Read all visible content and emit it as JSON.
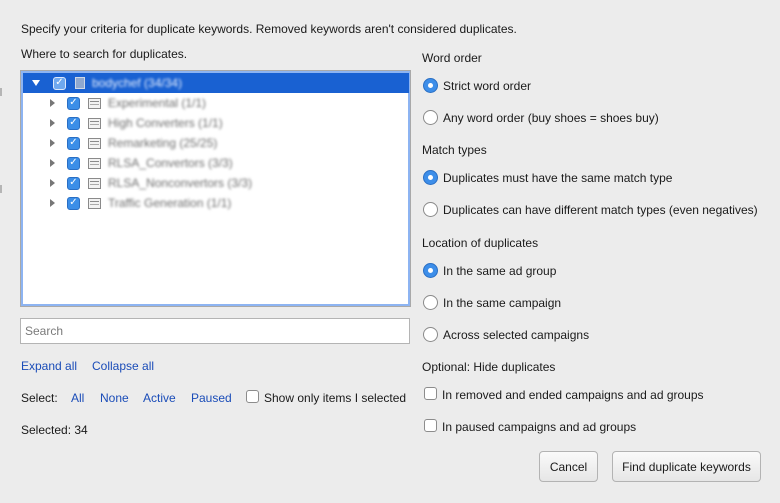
{
  "intro": "Specify your criteria for duplicate keywords. Removed keywords aren't considered duplicates.",
  "tree": {
    "label": "Where to search for duplicates.",
    "root": "bodychef (34/34)",
    "items": [
      "Experimental (1/1)",
      "High Converters (1/1)",
      "Remarketing (25/25)",
      "RLSA_Convertors (3/3)",
      "RLSA_Nonconvertors (3/3)",
      "Traffic Generation (1/1)"
    ]
  },
  "search": {
    "placeholder": "Search"
  },
  "expand_all": "Expand all",
  "collapse_all": "Collapse all",
  "select": {
    "label": "Select:",
    "all": "All",
    "none": "None",
    "active": "Active",
    "paused": "Paused",
    "show_only": "Show only items I selected"
  },
  "selected": "Selected: 34",
  "word_order": {
    "heading": "Word order",
    "strict": "Strict word order",
    "any": "Any word order (buy shoes = shoes buy)"
  },
  "match_types": {
    "heading": "Match types",
    "same": "Duplicates must have the same match type",
    "different": "Duplicates can have different match types (even negatives)"
  },
  "location": {
    "heading": "Location of duplicates",
    "ad_group": "In the same ad group",
    "campaign": "In the same campaign",
    "across": "Across selected campaigns"
  },
  "hide": {
    "heading": "Optional: Hide duplicates",
    "removed": "In removed and ended campaigns and ad groups",
    "paused": "In paused campaigns and ad groups"
  },
  "buttons": {
    "cancel": "Cancel",
    "find": "Find duplicate keywords"
  },
  "colors": {
    "selection": "#1961d2",
    "link": "#1a4cb8",
    "accent": "#3d8ee9"
  }
}
